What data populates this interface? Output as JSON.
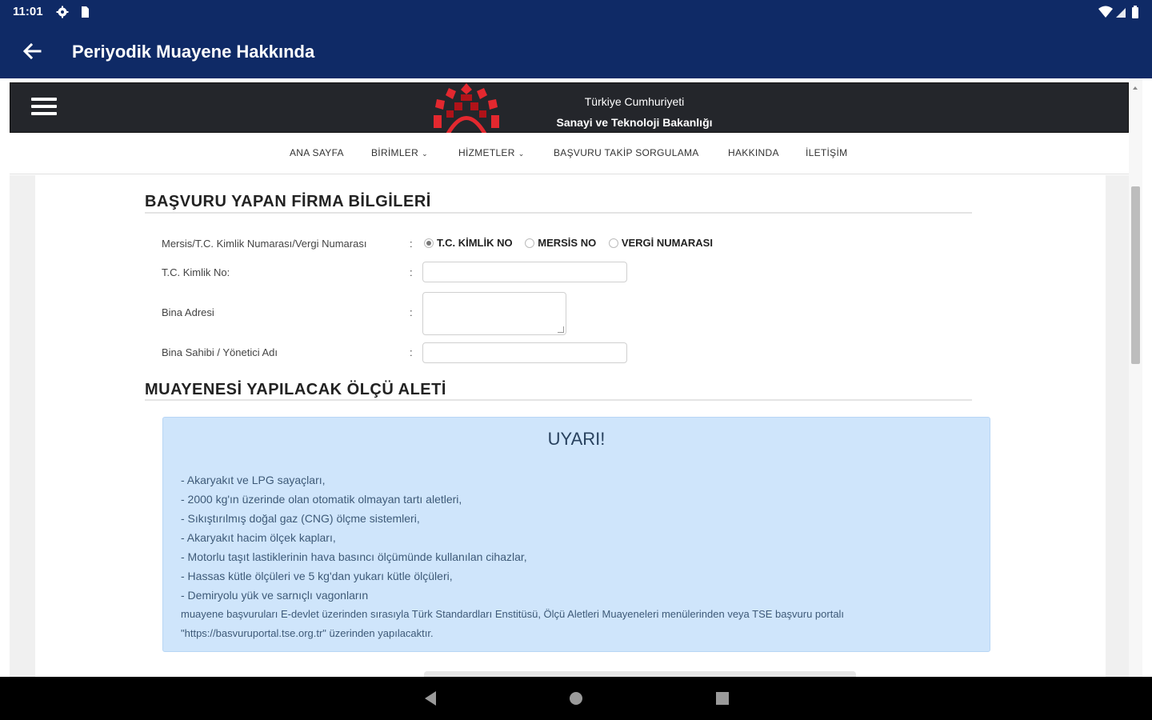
{
  "status_bar": {
    "time": "11:01",
    "icons": [
      "settings-icon",
      "sim-card-icon",
      "wifi-icon",
      "signal-icon",
      "battery-icon"
    ]
  },
  "app_bar": {
    "title": "Periyodik Muayene Hakkında",
    "back_icon": "arrow-back-icon"
  },
  "site_header": {
    "ministry_line1": "Türkiye Cumhuriyeti",
    "ministry_line2": "Sanayi ve Teknoloji Bakanlığı",
    "logo_colors": [
      "#e3282f",
      "#b01319"
    ]
  },
  "nav": {
    "items": [
      {
        "label": "ANA SAYFA"
      },
      {
        "label": "BİRİMLER",
        "dropdown": true
      },
      {
        "label": "HİZMETLER",
        "dropdown": true
      },
      {
        "label": "BAŞVURU TAKİP SORGULAMA"
      },
      {
        "label": "HAKKINDA"
      },
      {
        "label": "İLETİŞİM"
      }
    ]
  },
  "form": {
    "section1_title": "BAŞVURU YAPAN FİRMA BİLGİLERİ",
    "id_type_label": "Mersis/T.C. Kimlik Numarası/Vergi Numarası",
    "id_type_options": [
      "T.C. KİMLİK NO",
      "MERSİS NO",
      "VERGİ NUMARASI"
    ],
    "id_type_selected": "T.C. KİMLİK NO",
    "tc_label": "T.C. Kimlik No:",
    "tc_value": "",
    "address_label": "Bina Adresi",
    "address_value": "",
    "owner_label": "Bina Sahibi / Yönetici Adı",
    "owner_value": "",
    "colon": ":",
    "section2_title": "MUAYENESİ YAPILACAK ÖLÇÜ ALETİ"
  },
  "warning": {
    "title": "UYARI!",
    "lines": [
      "- Akaryakıt ve LPG sayaçları,",
      "- 2000 kg'ın üzerinde olan otomatik olmayan tartı aletleri,",
      "- Sıkıştırılmış doğal gaz (CNG) ölçme sistemleri,",
      "- Akaryakıt hacim ölçek kapları,",
      "- Motorlu taşıt lastiklerinin hava basıncı ölçümünde kullanılan cihazlar,",
      "- Hassas kütle ölçüleri ve 5 kg'dan yukarı kütle ölçüleri,",
      "- Demiryolu yük ve sarnıçlı vagonların"
    ],
    "footer1": "muayene başvuruları E-devlet üzerinden sırasıyla Türk Standardları Enstitüsü, Ölçü Aletleri Muayeneleri menülerinden veya TSE başvuru portalı",
    "footer2": "\"https://basvuruportal.tse.org.tr\" üzerinden yapılacaktır.",
    "bg_color": "#cfe5fb"
  },
  "system_nav": {
    "buttons": [
      "back-triangle-icon",
      "home-circle-icon",
      "recents-square-icon"
    ]
  }
}
